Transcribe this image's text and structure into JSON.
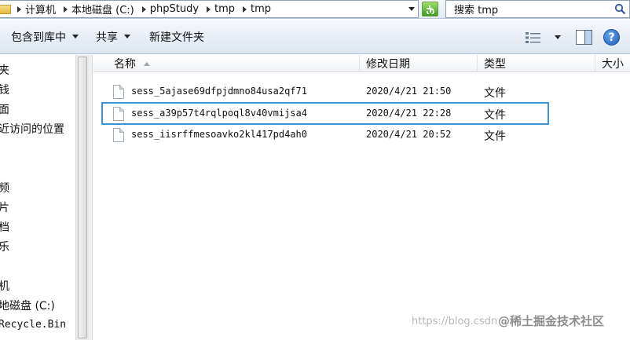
{
  "address_bar": {
    "crumbs": [
      "计算机",
      "本地磁盘 (C:)",
      "phpStudy",
      "tmp",
      "tmp"
    ]
  },
  "search": {
    "text": "搜索 tmp"
  },
  "toolbar": {
    "include_library": "包含到库中",
    "share": "共享",
    "new_folder": "新建文件夹",
    "help": "?"
  },
  "nav": {
    "items": [
      "夹",
      "钱",
      "面",
      "近访问的位置",
      "频",
      "片",
      "档",
      "乐",
      "机",
      "地磁盘 (C:)",
      "Recycle.Bin"
    ]
  },
  "columns": {
    "name": "名称",
    "modified": "修改日期",
    "type": "类型",
    "size": "大小"
  },
  "files": [
    {
      "name": "sess_5ajase69dfpjdmno84usa2qf71",
      "date": "2020/4/21 21:50",
      "type": "文件"
    },
    {
      "name": "sess_a39p57t4rqlpoql8v40vmijsa4",
      "date": "2020/4/21 22:28",
      "type": "文件"
    },
    {
      "name": "sess_iisrffmesoavko2kl417pd4ah0",
      "date": "2020/4/21 20:52",
      "type": "文件"
    }
  ],
  "watermark": {
    "url": "https://blog.csdn",
    "brand": "@稀土掘金技术社区"
  },
  "colors": {
    "highlight": "#3b95d2",
    "toolbar_bg": "#e8eef6"
  }
}
